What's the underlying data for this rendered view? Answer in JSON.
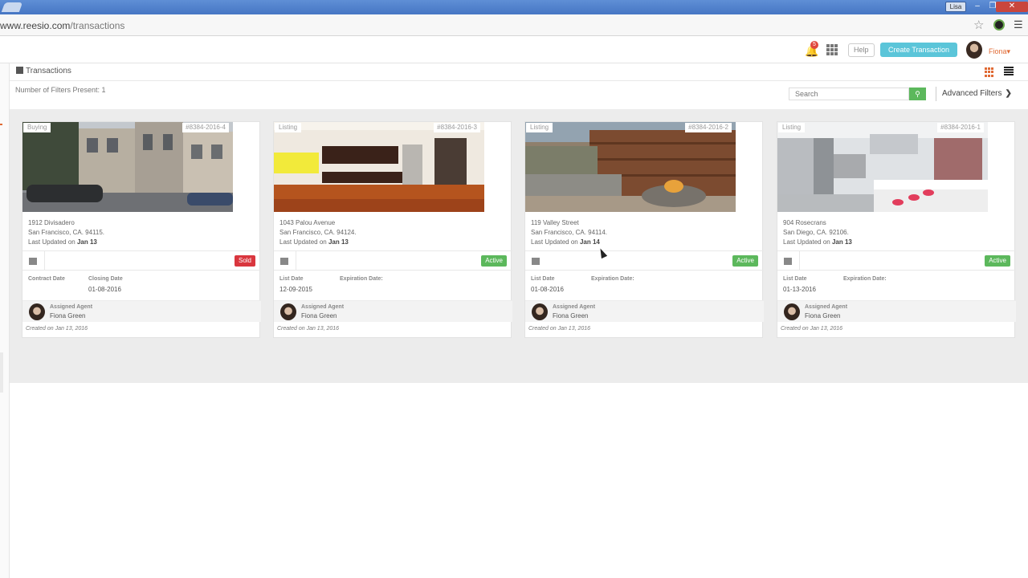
{
  "browser": {
    "user": "Lisa",
    "url_host": "www.reesio.com",
    "url_path": "/transactions"
  },
  "header": {
    "notification_count": "5",
    "help_label": "Help",
    "create_label": "Create Transaction",
    "user_name": "Fiona"
  },
  "page": {
    "title": "Transactions",
    "filter_count_text": "Number of Filters Present: 1",
    "search_placeholder": "Search",
    "advanced_filters_label": "Advanced Filters"
  },
  "cards": [
    {
      "type": "Buying",
      "id": "#8384-2016-4",
      "street": "1912 Divisadero",
      "city": "San Francisco, CA. 94115.",
      "updated_prefix": "Last Updated on",
      "updated_date": "Jan 13",
      "status": "Sold",
      "date1_label": "Contract Date",
      "date1_value": "",
      "date2_label": "Closing Date",
      "date2_value": "01-08-2016",
      "agent_label": "Assigned Agent",
      "agent_name": "Fiona Green",
      "created": "Created on Jan 13, 2016"
    },
    {
      "type": "Listing",
      "id": "#8384-2016-3",
      "street": "1043 Palou Avenue",
      "city": "San Francisco, CA. 94124.",
      "updated_prefix": "Last Updated on",
      "updated_date": "Jan 13",
      "status": "Active",
      "date1_label": "List Date",
      "date1_value": "12-09-2015",
      "date2_label": "Expiration Date:",
      "date2_value": "",
      "agent_label": "Assigned Agent",
      "agent_name": "Fiona Green",
      "created": "Created on Jan 13, 2016"
    },
    {
      "type": "Listing",
      "id": "#8384-2016-2",
      "street": "119 Valley Street",
      "city": "San Francisco, CA. 94114.",
      "updated_prefix": "Last Updated on",
      "updated_date": "Jan 14",
      "status": "Active",
      "date1_label": "List Date",
      "date1_value": "01-08-2016",
      "date2_label": "Expiration Date:",
      "date2_value": "",
      "agent_label": "Assigned Agent",
      "agent_name": "Fiona Green",
      "created": "Created on Jan 13, 2016"
    },
    {
      "type": "Listing",
      "id": "#8384-2016-1",
      "street": "904 Rosecrans",
      "city": "San Diego, CA. 92106.",
      "updated_prefix": "Last Updated on",
      "updated_date": "Jan 13",
      "status": "Active",
      "date1_label": "List Date",
      "date1_value": "01-13-2016",
      "date2_label": "Expiration Date:",
      "date2_value": "",
      "agent_label": "Assigned Agent",
      "agent_name": "Fiona Green",
      "created": "Created on Jan 13, 2016"
    }
  ],
  "colors": {
    "accent": "#e06a34",
    "create_button": "#5bc5d9",
    "status_sold": "#d9363e",
    "status_active": "#5cb85c"
  }
}
